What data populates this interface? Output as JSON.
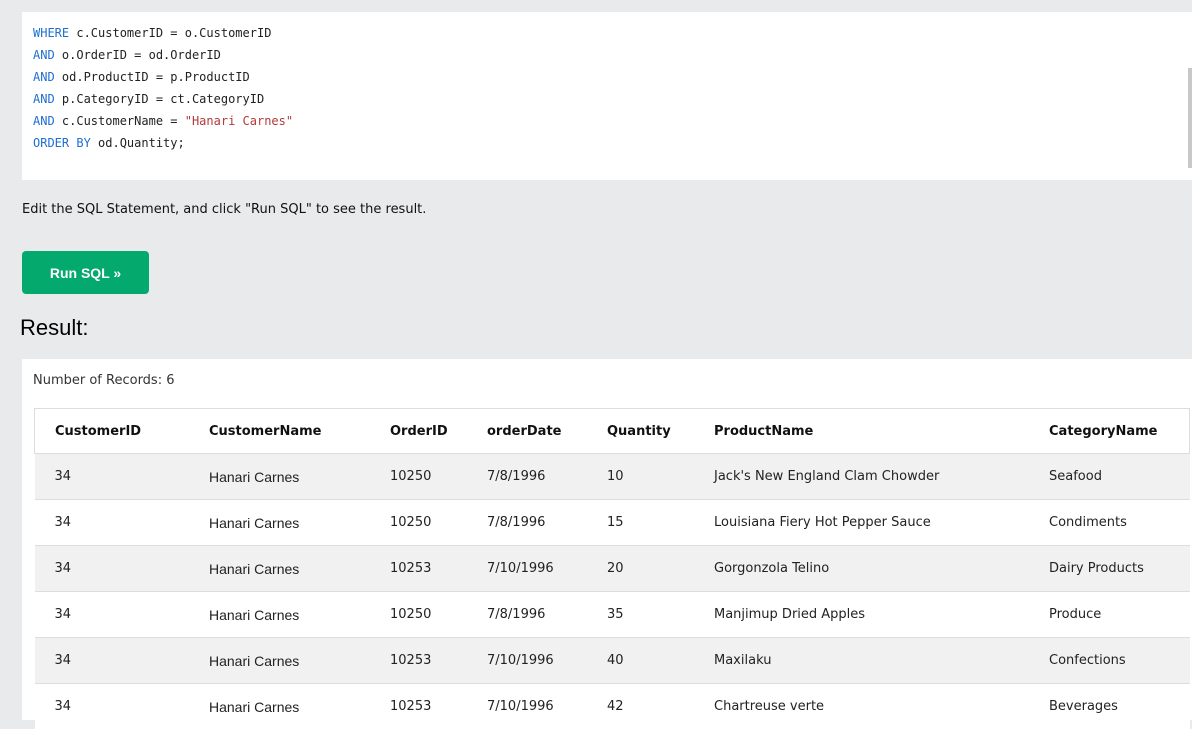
{
  "editor": {
    "lines": [
      {
        "kw": "WHERE",
        "rest": " c.CustomerID = o.CustomerID",
        "str": ""
      },
      {
        "kw": "AND",
        "rest": " o.OrderID = od.OrderID",
        "str": ""
      },
      {
        "kw": "AND",
        "rest": " od.ProductID = p.ProductID",
        "str": ""
      },
      {
        "kw": "AND",
        "rest": " p.CategoryID = ct.CategoryID",
        "str": ""
      },
      {
        "kw": "AND",
        "rest": " c.CustomerName = ",
        "str": "\"Hanari Carnes\""
      },
      {
        "kw": "ORDER BY",
        "rest": " od.Quantity;",
        "str": ""
      }
    ]
  },
  "instructions": "Edit the SQL Statement, and click \"Run SQL\" to see the result.",
  "run_button": "Run SQL »",
  "result_heading": "Result:",
  "record_count": "Number of Records: 6",
  "table": {
    "headers": [
      "CustomerID",
      "CustomerName",
      "OrderID",
      "orderDate",
      "Quantity",
      "ProductName",
      "CategoryName"
    ],
    "rows": [
      [
        "34",
        "Hanari Carnes",
        "10250",
        "7/8/1996",
        "10",
        "Jack's New England Clam Chowder",
        "Seafood"
      ],
      [
        "34",
        "Hanari Carnes",
        "10250",
        "7/8/1996",
        "15",
        "Louisiana Fiery Hot Pepper Sauce",
        "Condiments"
      ],
      [
        "34",
        "Hanari Carnes",
        "10253",
        "7/10/1996",
        "20",
        "Gorgonzola Telino",
        "Dairy Products"
      ],
      [
        "34",
        "Hanari Carnes",
        "10250",
        "7/8/1996",
        "35",
        "Manjimup Dried Apples",
        "Produce"
      ],
      [
        "34",
        "Hanari Carnes",
        "10253",
        "7/10/1996",
        "40",
        "Maxilaku",
        "Confections"
      ],
      [
        "34",
        "Hanari Carnes",
        "10253",
        "7/10/1996",
        "42",
        "Chartreuse verte",
        "Beverages"
      ]
    ]
  },
  "colors": {
    "run_button": "#04aa6d",
    "keyword": "#1e6fd0",
    "string": "#b23a3a",
    "background": "#e9eaec"
  }
}
